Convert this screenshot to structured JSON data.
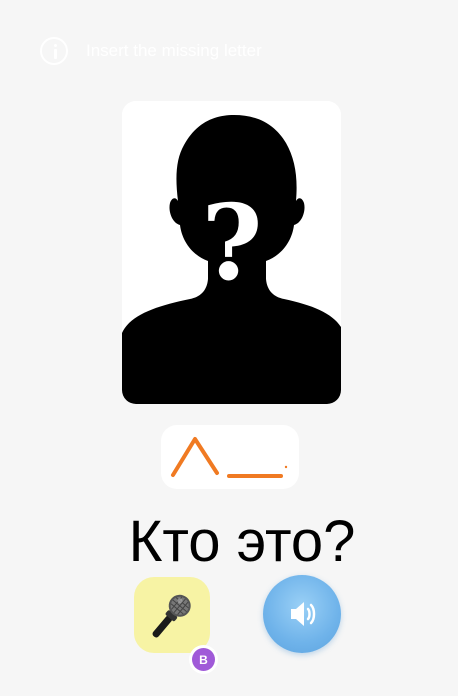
{
  "hint": {
    "text": "Insert the missing letter",
    "icon": "info-icon"
  },
  "card": {
    "image": "unknown-person-silhouette",
    "symbol": "?"
  },
  "word": {
    "letters": [
      "Λ",
      "_"
    ],
    "color": "#f07a22"
  },
  "question": "Кто это?",
  "buttons": {
    "mic_icon": "microphone-icon",
    "mic_color": "#f7f3a4",
    "sound_icon": "speaker-icon",
    "sound_color": "#6fb3ea"
  },
  "badge": {
    "text": "B",
    "color": "#a05ad8"
  }
}
